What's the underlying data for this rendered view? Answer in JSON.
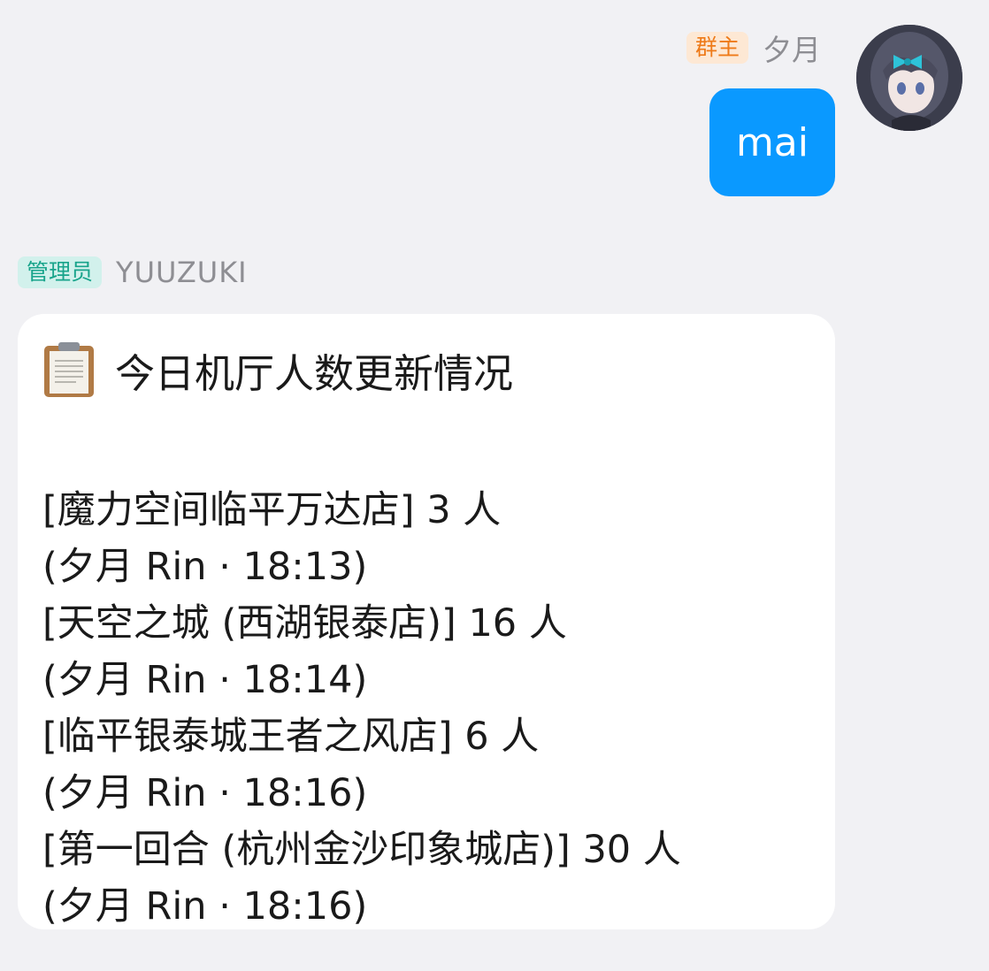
{
  "outgoing": {
    "badge": "群主",
    "sender": "夕月",
    "message": "mai",
    "avatar_icon": "anime-girl-avatar"
  },
  "incoming": {
    "badge": "管理员",
    "sender": "YUUZUKI",
    "title_icon": "clipboard-icon",
    "title": "今日机厅人数更新情况",
    "lines": [
      "[魔力空间临平万达店] 3 人",
      "(夕月 Rin · 18:13)",
      "[天空之城 (西湖银泰店)] 16 人",
      "(夕月 Rin · 18:14)",
      "[临平银泰城王者之风店] 6 人",
      "(夕月 Rin · 18:16)",
      "[第一回合 (杭州金沙印象城店)] 30 人",
      "(夕月 Rin · 18:16)"
    ]
  },
  "colors": {
    "background": "#f1f1f4",
    "outgoing_bubble": "#0a99ff",
    "owner_badge_bg": "#fde8d4",
    "owner_badge_text": "#ee7a18",
    "admin_badge_bg": "#d2f1ec",
    "admin_badge_text": "#19a48b"
  }
}
